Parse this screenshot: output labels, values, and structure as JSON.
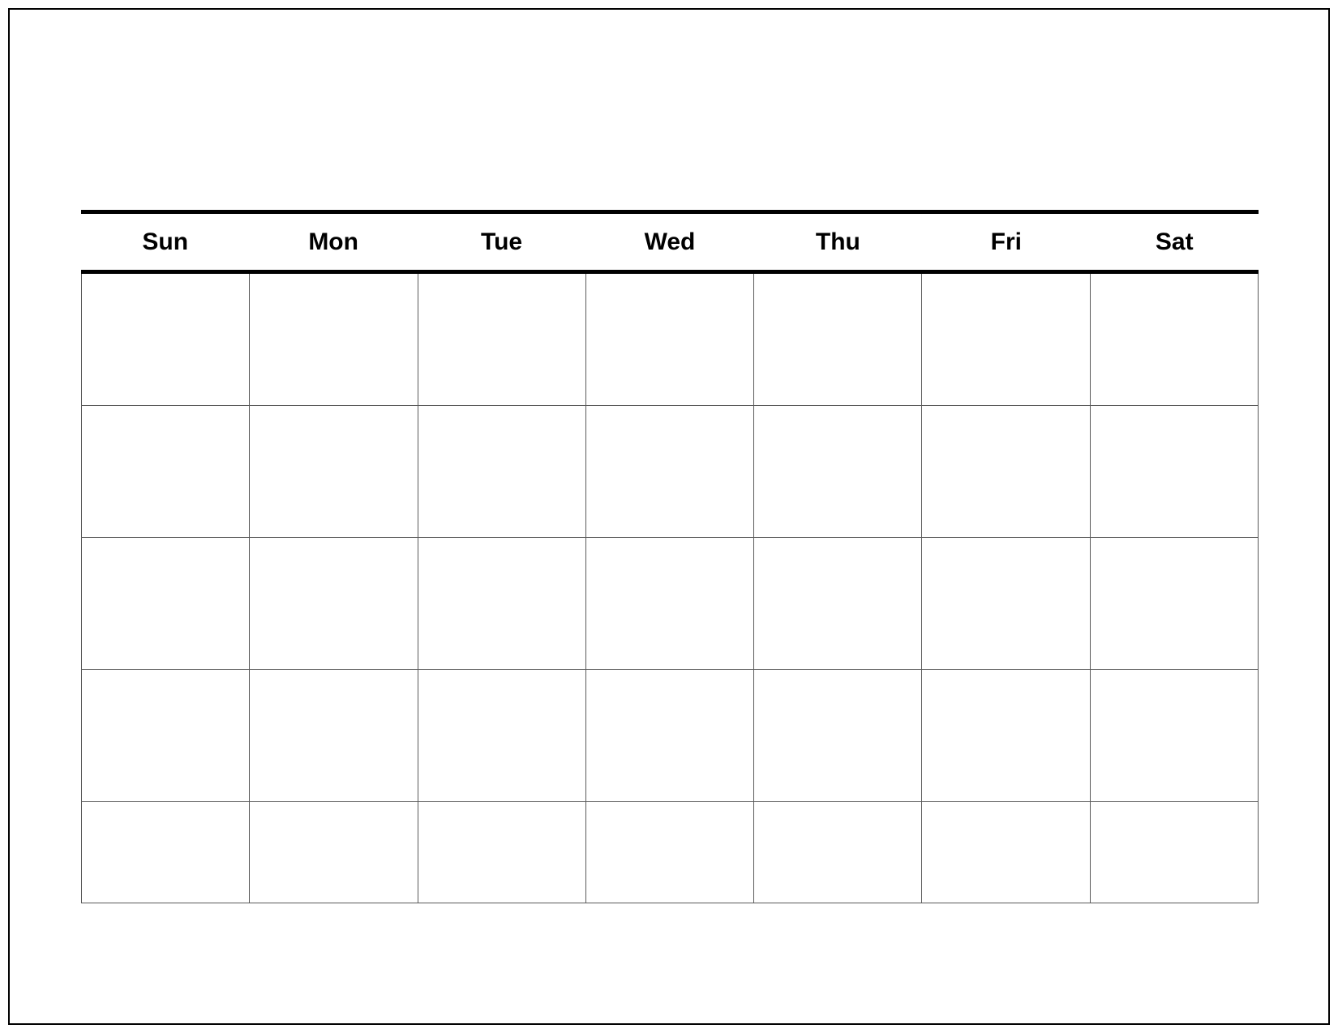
{
  "calendar": {
    "days": [
      "Sun",
      "Mon",
      "Tue",
      "Wed",
      "Thu",
      "Fri",
      "Sat"
    ],
    "rows": 5,
    "cols": 7
  }
}
